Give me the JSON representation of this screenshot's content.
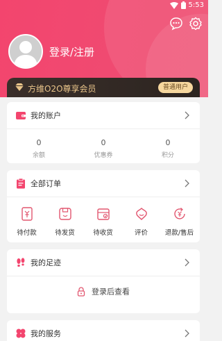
{
  "status_bar": {
    "time": "5:53"
  },
  "header": {
    "login_label": "登录/注册"
  },
  "vip": {
    "title": "方维O2O尊享会员",
    "badge": "普通用户"
  },
  "account": {
    "title": "我的账户",
    "stats": [
      {
        "value": "0",
        "label": "余额"
      },
      {
        "value": "0",
        "label": "优惠券"
      },
      {
        "value": "0",
        "label": "积分"
      }
    ]
  },
  "orders": {
    "title": "全部订单",
    "items": [
      {
        "label": "待付款",
        "icon": "pending-payment-icon"
      },
      {
        "label": "待发货",
        "icon": "pending-shipment-icon"
      },
      {
        "label": "待收货",
        "icon": "pending-receipt-icon"
      },
      {
        "label": "评价",
        "icon": "review-icon"
      },
      {
        "label": "退款/售后",
        "icon": "refund-icon"
      }
    ]
  },
  "footprints": {
    "title": "我的足迹",
    "login_hint": "登录后查看"
  },
  "services": {
    "title": "我的服务"
  },
  "colors": {
    "brand": "#f3456e",
    "accent_gold": "#e9c48a",
    "vip_dark": "#2c2420"
  }
}
